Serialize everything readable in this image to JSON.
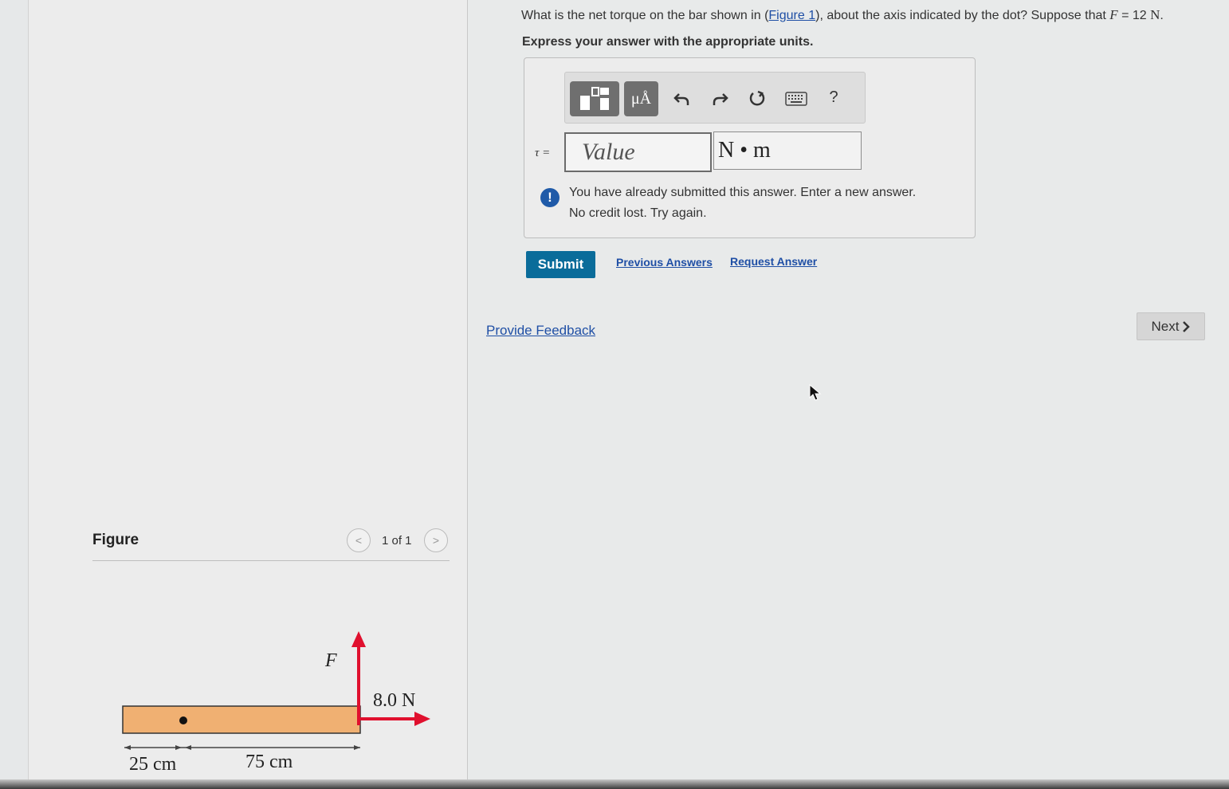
{
  "question": {
    "prefix": "What is the net torque on the bar shown in (",
    "figure_link": "Figure 1",
    "suffix": "), about the axis indicated by the dot? Suppose that ",
    "variable": "F",
    "equals": " = 12 ",
    "unit": "N",
    "end": "."
  },
  "instruction": "Express your answer with the appropriate units.",
  "toolbar": {
    "templates_icon": "templates-icon",
    "units_label": "μÅ",
    "undo_icon": "undo-icon",
    "redo_icon": "redo-icon",
    "reset_icon": "reset-icon",
    "keyboard_icon": "keyboard-icon",
    "help_label": "?"
  },
  "answer": {
    "label": "τ =",
    "value_placeholder": "Value",
    "value": "",
    "units": "N • m"
  },
  "alert": {
    "icon": "!",
    "line1": "You have already submitted this answer. Enter a new answer.",
    "line2": "No credit lost. Try again."
  },
  "actions": {
    "submit": "Submit",
    "previous_answers": "Previous Answers",
    "request_answer": "Request Answer",
    "provide_feedback": "Provide Feedback",
    "next": "Next"
  },
  "figure": {
    "title": "Figure",
    "counter": "1 of 1",
    "force_label": "F",
    "force2_label": "8.0 N",
    "dim1": "25 cm",
    "dim2": "75 cm",
    "bar_color": "#f0b072",
    "arrow_color": "#e0102e"
  }
}
